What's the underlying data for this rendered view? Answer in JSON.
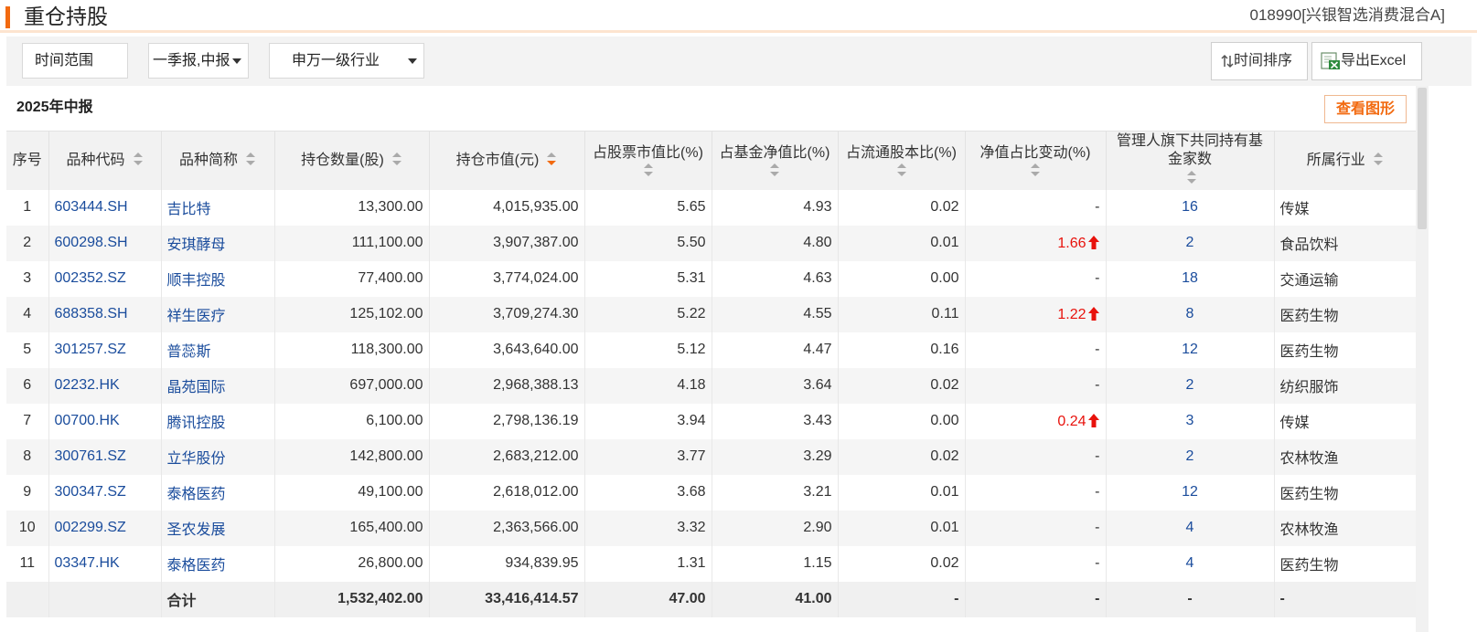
{
  "header": {
    "title": "重仓持股",
    "fund": "018990[兴银智选消费混合A]"
  },
  "toolbar": {
    "time_range_label": "时间范围",
    "period_select": "一季报,中报",
    "industry_select": "申万一级行业",
    "time_sort_label": "时间排序",
    "export_label": "导出Excel"
  },
  "report": {
    "title": "2025年中报",
    "view_graph_label": "查看图形"
  },
  "table": {
    "columns": [
      "序号",
      "品种代码",
      "品种简称",
      "持仓数量(股)",
      "持仓市值(元)",
      "占股票市值比(%)",
      "占基金净值比(%)",
      "占流通股本比(%)",
      "净值占比变动(%)",
      "管理人旗下共同持有基金家数",
      "所属行业"
    ],
    "rows": [
      {
        "idx": "1",
        "code": "603444.SH",
        "name": "吉比特",
        "qty": "13,300.00",
        "mv": "4,015,935.00",
        "stock_pct": "5.65",
        "nav_pct": "4.93",
        "float_pct": "0.02",
        "change": "-",
        "change_up": false,
        "funds": "16",
        "industry": "传媒"
      },
      {
        "idx": "2",
        "code": "600298.SH",
        "name": "安琪酵母",
        "qty": "111,100.00",
        "mv": "3,907,387.00",
        "stock_pct": "5.50",
        "nav_pct": "4.80",
        "float_pct": "0.01",
        "change": "1.66",
        "change_up": true,
        "funds": "2",
        "industry": "食品饮料"
      },
      {
        "idx": "3",
        "code": "002352.SZ",
        "name": "顺丰控股",
        "qty": "77,400.00",
        "mv": "3,774,024.00",
        "stock_pct": "5.31",
        "nav_pct": "4.63",
        "float_pct": "0.00",
        "change": "-",
        "change_up": false,
        "funds": "18",
        "industry": "交通运输"
      },
      {
        "idx": "4",
        "code": "688358.SH",
        "name": "祥生医疗",
        "qty": "125,102.00",
        "mv": "3,709,274.30",
        "stock_pct": "5.22",
        "nav_pct": "4.55",
        "float_pct": "0.11",
        "change": "1.22",
        "change_up": true,
        "funds": "8",
        "industry": "医药生物"
      },
      {
        "idx": "5",
        "code": "301257.SZ",
        "name": "普蕊斯",
        "qty": "118,300.00",
        "mv": "3,643,640.00",
        "stock_pct": "5.12",
        "nav_pct": "4.47",
        "float_pct": "0.16",
        "change": "-",
        "change_up": false,
        "funds": "12",
        "industry": "医药生物"
      },
      {
        "idx": "6",
        "code": "02232.HK",
        "name": "晶苑国际",
        "qty": "697,000.00",
        "mv": "2,968,388.13",
        "stock_pct": "4.18",
        "nav_pct": "3.64",
        "float_pct": "0.02",
        "change": "-",
        "change_up": false,
        "funds": "2",
        "industry": "纺织服饰"
      },
      {
        "idx": "7",
        "code": "00700.HK",
        "name": "腾讯控股",
        "qty": "6,100.00",
        "mv": "2,798,136.19",
        "stock_pct": "3.94",
        "nav_pct": "3.43",
        "float_pct": "0.00",
        "change": "0.24",
        "change_up": true,
        "funds": "3",
        "industry": "传媒"
      },
      {
        "idx": "8",
        "code": "300761.SZ",
        "name": "立华股份",
        "qty": "142,800.00",
        "mv": "2,683,212.00",
        "stock_pct": "3.77",
        "nav_pct": "3.29",
        "float_pct": "0.02",
        "change": "-",
        "change_up": false,
        "funds": "2",
        "industry": "农林牧渔"
      },
      {
        "idx": "9",
        "code": "300347.SZ",
        "name": "泰格医药",
        "qty": "49,100.00",
        "mv": "2,618,012.00",
        "stock_pct": "3.68",
        "nav_pct": "3.21",
        "float_pct": "0.01",
        "change": "-",
        "change_up": false,
        "funds": "12",
        "industry": "医药生物"
      },
      {
        "idx": "10",
        "code": "002299.SZ",
        "name": "圣农发展",
        "qty": "165,400.00",
        "mv": "2,363,566.00",
        "stock_pct": "3.32",
        "nav_pct": "2.90",
        "float_pct": "0.01",
        "change": "-",
        "change_up": false,
        "funds": "4",
        "industry": "农林牧渔"
      },
      {
        "idx": "11",
        "code": "03347.HK",
        "name": "泰格医药",
        "qty": "26,800.00",
        "mv": "934,839.95",
        "stock_pct": "1.31",
        "nav_pct": "1.15",
        "float_pct": "0.02",
        "change": "-",
        "change_up": false,
        "funds": "4",
        "industry": "医药生物"
      }
    ],
    "total": {
      "label": "合计",
      "qty": "1,532,402.00",
      "mv": "33,416,414.57",
      "stock_pct": "47.00",
      "nav_pct": "41.00",
      "float_pct": "-",
      "change": "-",
      "funds": "-",
      "industry": "-"
    }
  },
  "colors": {
    "accent": "#f26a10",
    "link": "#1a4c9c",
    "up": "#e8120c"
  }
}
